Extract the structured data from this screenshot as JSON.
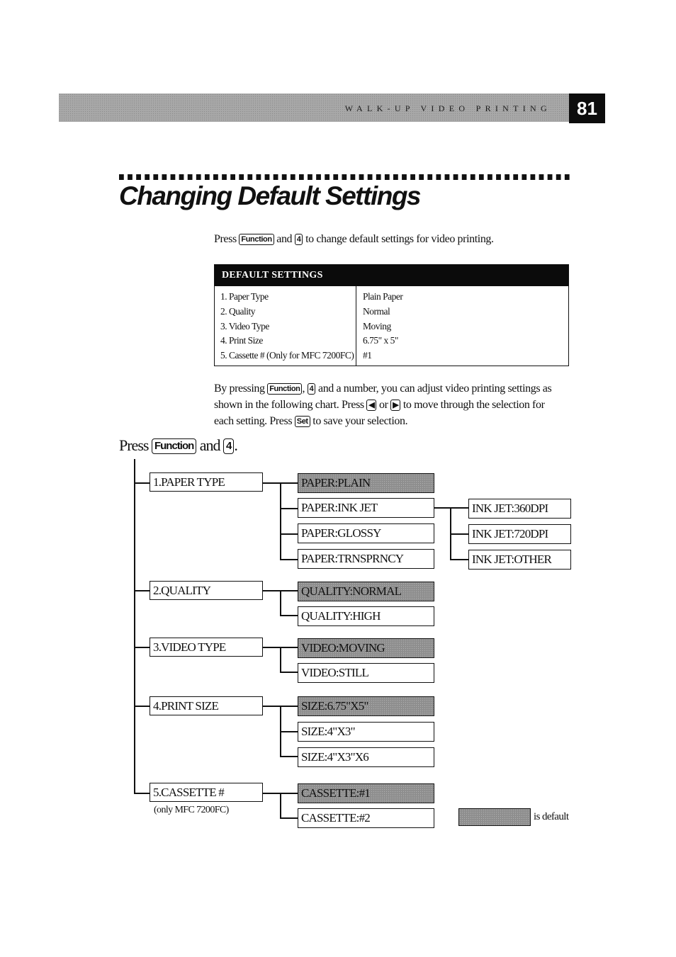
{
  "header": {
    "section_title": "WALK-UP VIDEO PRINTING",
    "page_number": "81"
  },
  "title": "Changing Default Settings",
  "intro": {
    "text1": "Press",
    "key1": "Function",
    "text2": "and",
    "key2": "4",
    "text3": "to change default settings for video printing."
  },
  "defaults_table": {
    "heading": "DEFAULT SETTINGS",
    "rows": [
      {
        "setting": "1.  Paper Type",
        "value": "Plain Paper"
      },
      {
        "setting": "2.  Quality",
        "value": "Normal"
      },
      {
        "setting": "3.  Video Type",
        "value": "Moving"
      },
      {
        "setting": "4.  Print Size",
        "value": "6.75\" x 5\""
      },
      {
        "setting": "5.  Cassette # (Only for MFC 7200FC)",
        "value": "#1"
      }
    ]
  },
  "instructions": {
    "p1_a": "By  pressing",
    "key_function": "Function",
    "p1_b": ",",
    "key_4": "4",
    "p1_c": "and a number, you can adjust video printing settings as",
    "p2_a": "shown in the following chart. Press",
    "key_left": "◀",
    "p2_b": "or",
    "key_right": "▶",
    "p2_c": "to move through the selection for",
    "p3_a": "each setting. Press",
    "key_set": "Set",
    "p3_b": "to save your selection."
  },
  "chart_intro": {
    "text1": "Press",
    "key1": "Function",
    "text2": "and",
    "key2": "4",
    "text3": "."
  },
  "tree": {
    "categories": [
      {
        "label": "1.PAPER TYPE",
        "options": [
          {
            "label": "PAPER:PLAIN",
            "default": true
          },
          {
            "label": "PAPER:INK JET",
            "default": false,
            "suboptions": [
              "INK JET:360DPI",
              "INK JET:720DPI",
              "INK JET:OTHER"
            ]
          },
          {
            "label": "PAPER:GLOSSY",
            "default": false
          },
          {
            "label": "PAPER:TRNSPRNCY",
            "default": false
          }
        ]
      },
      {
        "label": "2.QUALITY",
        "options": [
          {
            "label": "QUALITY:NORMAL",
            "default": true
          },
          {
            "label": "QUALITY:HIGH",
            "default": false
          }
        ]
      },
      {
        "label": "3.VIDEO TYPE",
        "options": [
          {
            "label": "VIDEO:MOVING",
            "default": true
          },
          {
            "label": "VIDEO:STILL",
            "default": false
          }
        ]
      },
      {
        "label": "4.PRINT SIZE",
        "options": [
          {
            "label": "SIZE:6.75\"X5\"",
            "default": true
          },
          {
            "label": "SIZE:4\"X3\"",
            "default": false
          },
          {
            "label": "SIZE:4\"X3\"X6",
            "default": false
          }
        ]
      },
      {
        "label": "5.CASSETTE #",
        "note": "(only MFC 7200FC)",
        "options": [
          {
            "label": "CASSETTE:#1",
            "default": true
          },
          {
            "label": "CASSETTE:#2",
            "default": false
          }
        ]
      }
    ],
    "legend": "is default"
  }
}
